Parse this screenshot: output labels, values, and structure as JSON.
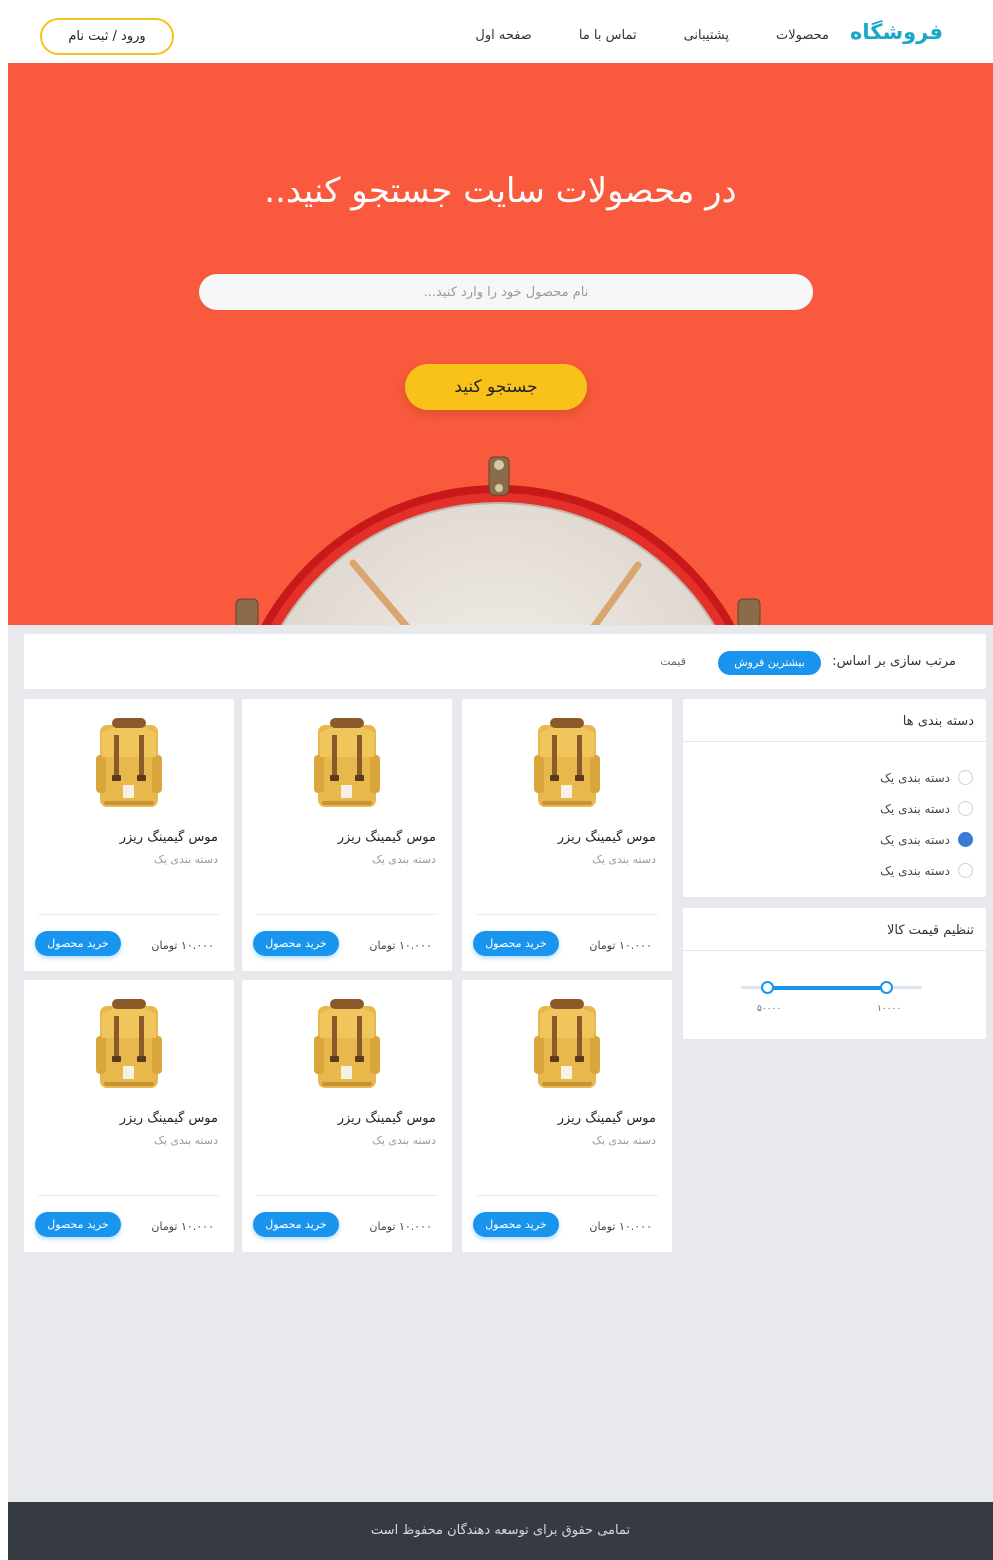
{
  "header": {
    "brand": "فروشگاه",
    "nav": [
      "صفحه اول",
      "تماس با ما",
      "پشتیبانی",
      "محصولات"
    ],
    "login_label": "ورود / ثبت نام"
  },
  "hero": {
    "title": "در محصولات سایت جستجو کنید..",
    "search_placeholder": "نام محصول خود را وارد کنید...",
    "search_button": "جستجو کنید"
  },
  "sort": {
    "label": "مرتب سازی بر اساس:",
    "options": [
      "بیشترین فروش",
      "قیمت"
    ],
    "active": "بیشترین فروش"
  },
  "sidebar": {
    "categories_title": "دسته بندی ها",
    "categories": [
      {
        "label": "دسته بندی یک",
        "selected": false
      },
      {
        "label": "دسته بندی یک",
        "selected": false
      },
      {
        "label": "دسته بندی یک",
        "selected": true
      },
      {
        "label": "دسته بندی یک",
        "selected": false
      }
    ],
    "price_title": "تنظیم قیمت کالا",
    "price_min_label": "۱۰۰۰۰",
    "price_max_label": "۵۰۰۰۰"
  },
  "products": [
    {
      "name": "موس گیمینگ ریزر",
      "category": "دسته بندی یک",
      "price": "۱۰.۰۰۰ تومان",
      "buy": "خرید محصول"
    },
    {
      "name": "موس گیمینگ ریزر",
      "category": "دسته بندی یک",
      "price": "۱۰.۰۰۰ تومان",
      "buy": "خرید محصول"
    },
    {
      "name": "موس گیمینگ ریزر",
      "category": "دسته بندی یک",
      "price": "۱۰.۰۰۰ تومان",
      "buy": "خرید محصول"
    },
    {
      "name": "موس گیمینگ ریزر",
      "category": "دسته بندی یک",
      "price": "۱۰.۰۰۰ تومان",
      "buy": "خرید محصول"
    },
    {
      "name": "موس گیمینگ ریزر",
      "category": "دسته بندی یک",
      "price": "۱۰.۰۰۰ تومان",
      "buy": "خرید محصول"
    },
    {
      "name": "موس گیمینگ ریزر",
      "category": "دسته بندی یک",
      "price": "۱۰.۰۰۰ تومان",
      "buy": "خرید محصول"
    }
  ],
  "footer": {
    "text": "تمامی حقوق برای توسعه دهندگان محفوظ است"
  },
  "colors": {
    "brand": "#1ba8c6",
    "hero_bg": "#f95a3d",
    "accent_yellow": "#f9c21b",
    "accent_blue": "#1a95ee",
    "footer_bg": "#363b41"
  }
}
